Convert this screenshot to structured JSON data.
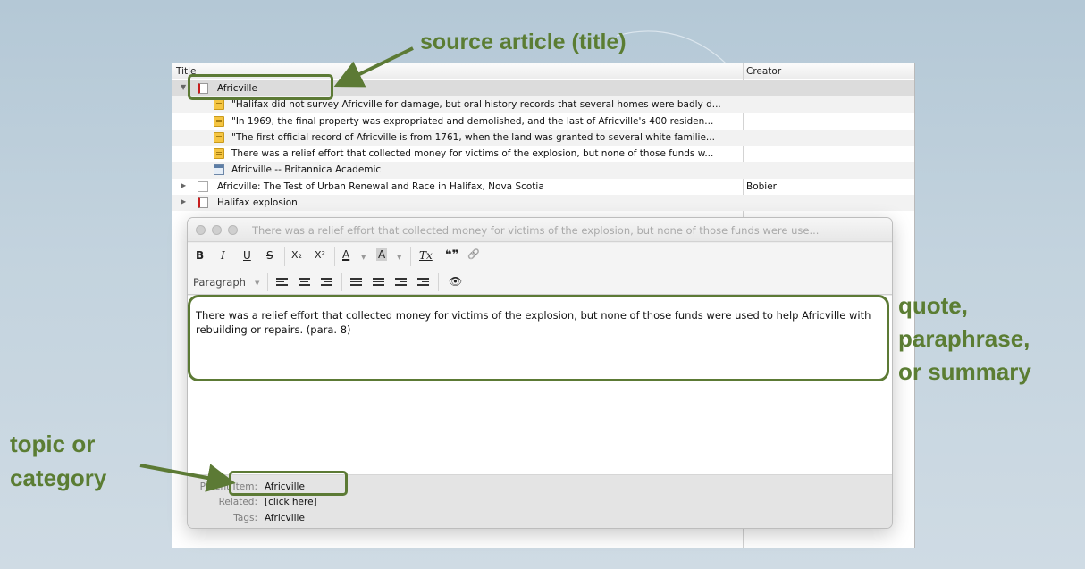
{
  "columns": {
    "title": "Title",
    "creator": "Creator"
  },
  "tree": {
    "rows": [
      {
        "label": "Africville",
        "creator": "",
        "icon": "book-icon",
        "twisty": "▼"
      },
      {
        "label": "\"Halifax did not survey Africville for damage, but oral history records that several homes were badly d...",
        "creator": "",
        "icon": "note-icon"
      },
      {
        "label": "\"In 1969, the final property was expropriated and demolished, and the last of Africville's 400 residen...",
        "creator": "",
        "icon": "note-icon"
      },
      {
        "label": "\"The first official record of Africville is from 1761, when the land was granted to several white familie...",
        "creator": "",
        "icon": "note-icon"
      },
      {
        "label": "There was a relief effort that collected money for victims of the explosion, but none of those funds w...",
        "creator": "",
        "icon": "note-icon"
      },
      {
        "label": "Africville -- Britannica Academic",
        "creator": "",
        "icon": "webpage-icon"
      },
      {
        "label": "Africville: The Test of Urban Renewal and Race in Halifax, Nova Scotia",
        "creator": "Bobier",
        "icon": "document-icon",
        "twisty": "▶"
      },
      {
        "label": "Halifax explosion",
        "creator": "",
        "icon": "book-icon",
        "twisty": "▶"
      }
    ]
  },
  "note_window": {
    "title": "There was a relief effort that collected money for victims of the explosion, but none of those funds were use...",
    "toolbar": {
      "bold": "B",
      "italic": "I",
      "underline": "U",
      "strike": "S",
      "subscript": "X₂",
      "superscript": "X²",
      "font_color": "A",
      "highlight": "A",
      "clear_format": "Tx",
      "quote": "❝❞",
      "link": "🔗",
      "paragraph": "Paragraph",
      "find": "👁"
    },
    "body_text": "There was a relief effort that collected money for victims of the explosion, but none of those funds were used to help Africville with rebuilding or repairs. (para. 8)",
    "meta": {
      "parent_label": "Parent Item:",
      "parent_value": "Africville",
      "related_label": "Related:",
      "related_value": "[click here]",
      "tags_label": "Tags:",
      "tags_value": "Africville"
    }
  },
  "annotations": {
    "source_article": "source article (title)",
    "quote": [
      "quote,",
      "paraphrase,",
      "or summary"
    ],
    "topic": [
      "topic or",
      "category"
    ],
    "accent_color": "#5c7a35"
  }
}
